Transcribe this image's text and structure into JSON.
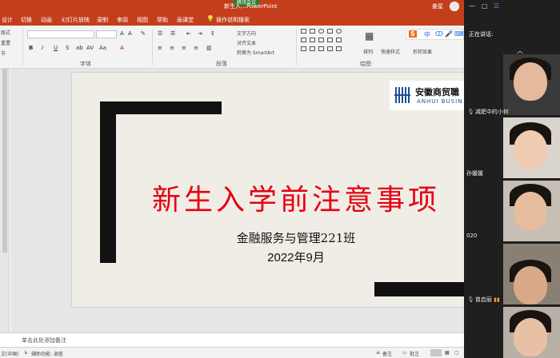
{
  "window": {
    "title": "新生入…PowerPoint",
    "user_name": "姜星",
    "tencent_badge": "腾讯会议"
  },
  "menu": {
    "tabs": [
      "设计",
      "切换",
      "动画",
      "幻灯片放映",
      "录制",
      "审阅",
      "视图",
      "帮助",
      "画课堂"
    ],
    "search": "操作说明搜索"
  },
  "ribbon": {
    "left_items": [
      "版式",
      "重置",
      "节"
    ],
    "font_group_label": "字体",
    "paragraph_group_label": "段落",
    "drawing_group_label": "绘图",
    "text_direction": "文字方向",
    "align_text": "对齐文本",
    "smartart": "转换为 SmartArt",
    "arrange": "排列",
    "quick_styles": "快速样式",
    "shape_effects": "形状效果",
    "font_style_buttons": [
      "B",
      "I",
      "U",
      "S",
      "ab",
      "AV",
      "Aa"
    ],
    "sougou_items": [
      "S",
      "中",
      "ↀ",
      "🎤",
      "⌨"
    ]
  },
  "slide": {
    "title": "新生入学前注意事项",
    "subtitle": "金融服务与管理221班",
    "date": "2022年9月",
    "logo_cn": "安徽商贸職",
    "logo_en": "ANHUI BUSIN"
  },
  "notes": {
    "placeholder": "单击此处添加备注"
  },
  "statusbar": {
    "language": "文(中国)",
    "accessibility": "辅助功能: 调查",
    "notes_btn": "备注",
    "comments_btn": "批注"
  },
  "meeting": {
    "speaking_label": "正在讲话:",
    "participants": [
      {
        "name": "减肥中的小何"
      },
      {
        "name": "孙媛媛"
      },
      {
        "name": "020"
      },
      {
        "name": "曾启丽"
      },
      {
        "name": ""
      }
    ]
  },
  "colors": {
    "ribbon_red": "#c43e1c",
    "title_red": "#e60012",
    "slide_bg": "#f0ede6"
  }
}
